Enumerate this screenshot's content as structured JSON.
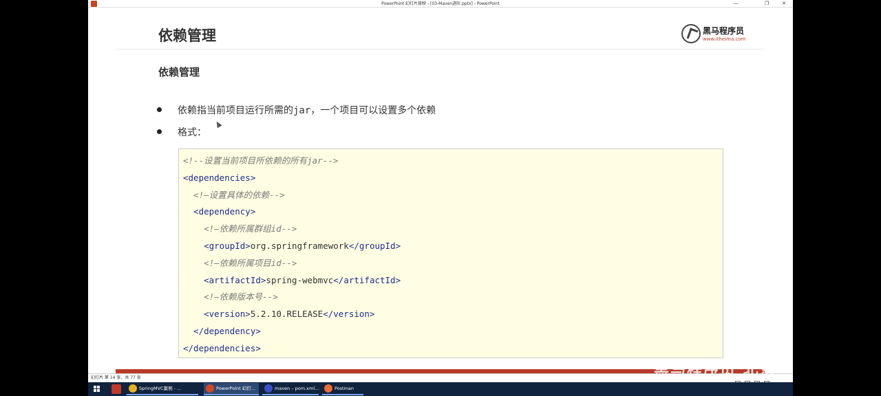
{
  "window": {
    "title": "PowerPoint 幻灯片放映 - [03-Maven进阶.pptx] - PowerPoint",
    "minimize": "—",
    "restore": "❐",
    "close": "✕"
  },
  "slide": {
    "title": "依赖管理",
    "logo": {
      "name": "黑马程序员",
      "url": "www.itheima.com"
    },
    "subtitle": "依赖管理",
    "bullets": [
      {
        "before": "依赖指当前项目运行所需的",
        "code": "jar",
        "after": "，一个项目可以设置多个依赖"
      },
      {
        "before": "格式：",
        "code": "",
        "after": ""
      }
    ],
    "code_lines": [
      {
        "parts": [
          {
            "t": "comment",
            "v": "<!--设置当前项目所依赖的所有jar-->"
          }
        ]
      },
      {
        "parts": [
          {
            "t": "tag",
            "v": "<dependencies>"
          }
        ]
      },
      {
        "parts": [
          {
            "t": "comment",
            "v": "  <!—设置具体的依赖-->"
          }
        ]
      },
      {
        "parts": [
          {
            "t": "tag",
            "v": "  <dependency>"
          }
        ]
      },
      {
        "parts": [
          {
            "t": "comment",
            "v": "    <!—依赖所属群组id-->"
          }
        ]
      },
      {
        "parts": [
          {
            "t": "tag",
            "v": "    <groupId>"
          },
          {
            "t": "text",
            "v": "org.springframework"
          },
          {
            "t": "tag",
            "v": "</groupId>"
          }
        ]
      },
      {
        "parts": [
          {
            "t": "comment",
            "v": "    <!—依赖所属项目id-->"
          }
        ]
      },
      {
        "parts": [
          {
            "t": "tag",
            "v": "    <artifactId>"
          },
          {
            "t": "text",
            "v": "spring-webmvc"
          },
          {
            "t": "tag",
            "v": "</artifactId>"
          }
        ]
      },
      {
        "parts": [
          {
            "t": "comment",
            "v": "    <!—依赖版本号-->"
          }
        ]
      },
      {
        "parts": [
          {
            "t": "tag",
            "v": "    <version>"
          },
          {
            "t": "text",
            "v": "5.2.10.RELEASE"
          },
          {
            "t": "tag",
            "v": "</version>"
          }
        ]
      },
      {
        "parts": [
          {
            "t": "tag",
            "v": "  </dependency>"
          }
        ]
      },
      {
        "parts": [
          {
            "t": "tag",
            "v": "</dependencies>"
          }
        ]
      }
    ]
  },
  "statusbar": {
    "text": "幻灯片 第 14 张，共 77 张"
  },
  "watermark": "黑马程序员 北京",
  "taskbar": {
    "apps": [
      {
        "label": "SpringMVC案例 - ...",
        "color": "#e8b020",
        "active": false
      },
      {
        "label": "PowerPoint 幻灯...",
        "color": "#d24726",
        "active": true
      },
      {
        "label": "maven – pom.xml...",
        "color": "#3a4fc8",
        "active": false
      },
      {
        "label": "Postman",
        "color": "#ef6c35",
        "active": false
      }
    ]
  },
  "colors": {
    "accent": "#c13a28",
    "code_bg": "#fffde2",
    "tag": "#1c2d91",
    "comment": "#7b7b7b",
    "taskbar": "#10233f"
  }
}
